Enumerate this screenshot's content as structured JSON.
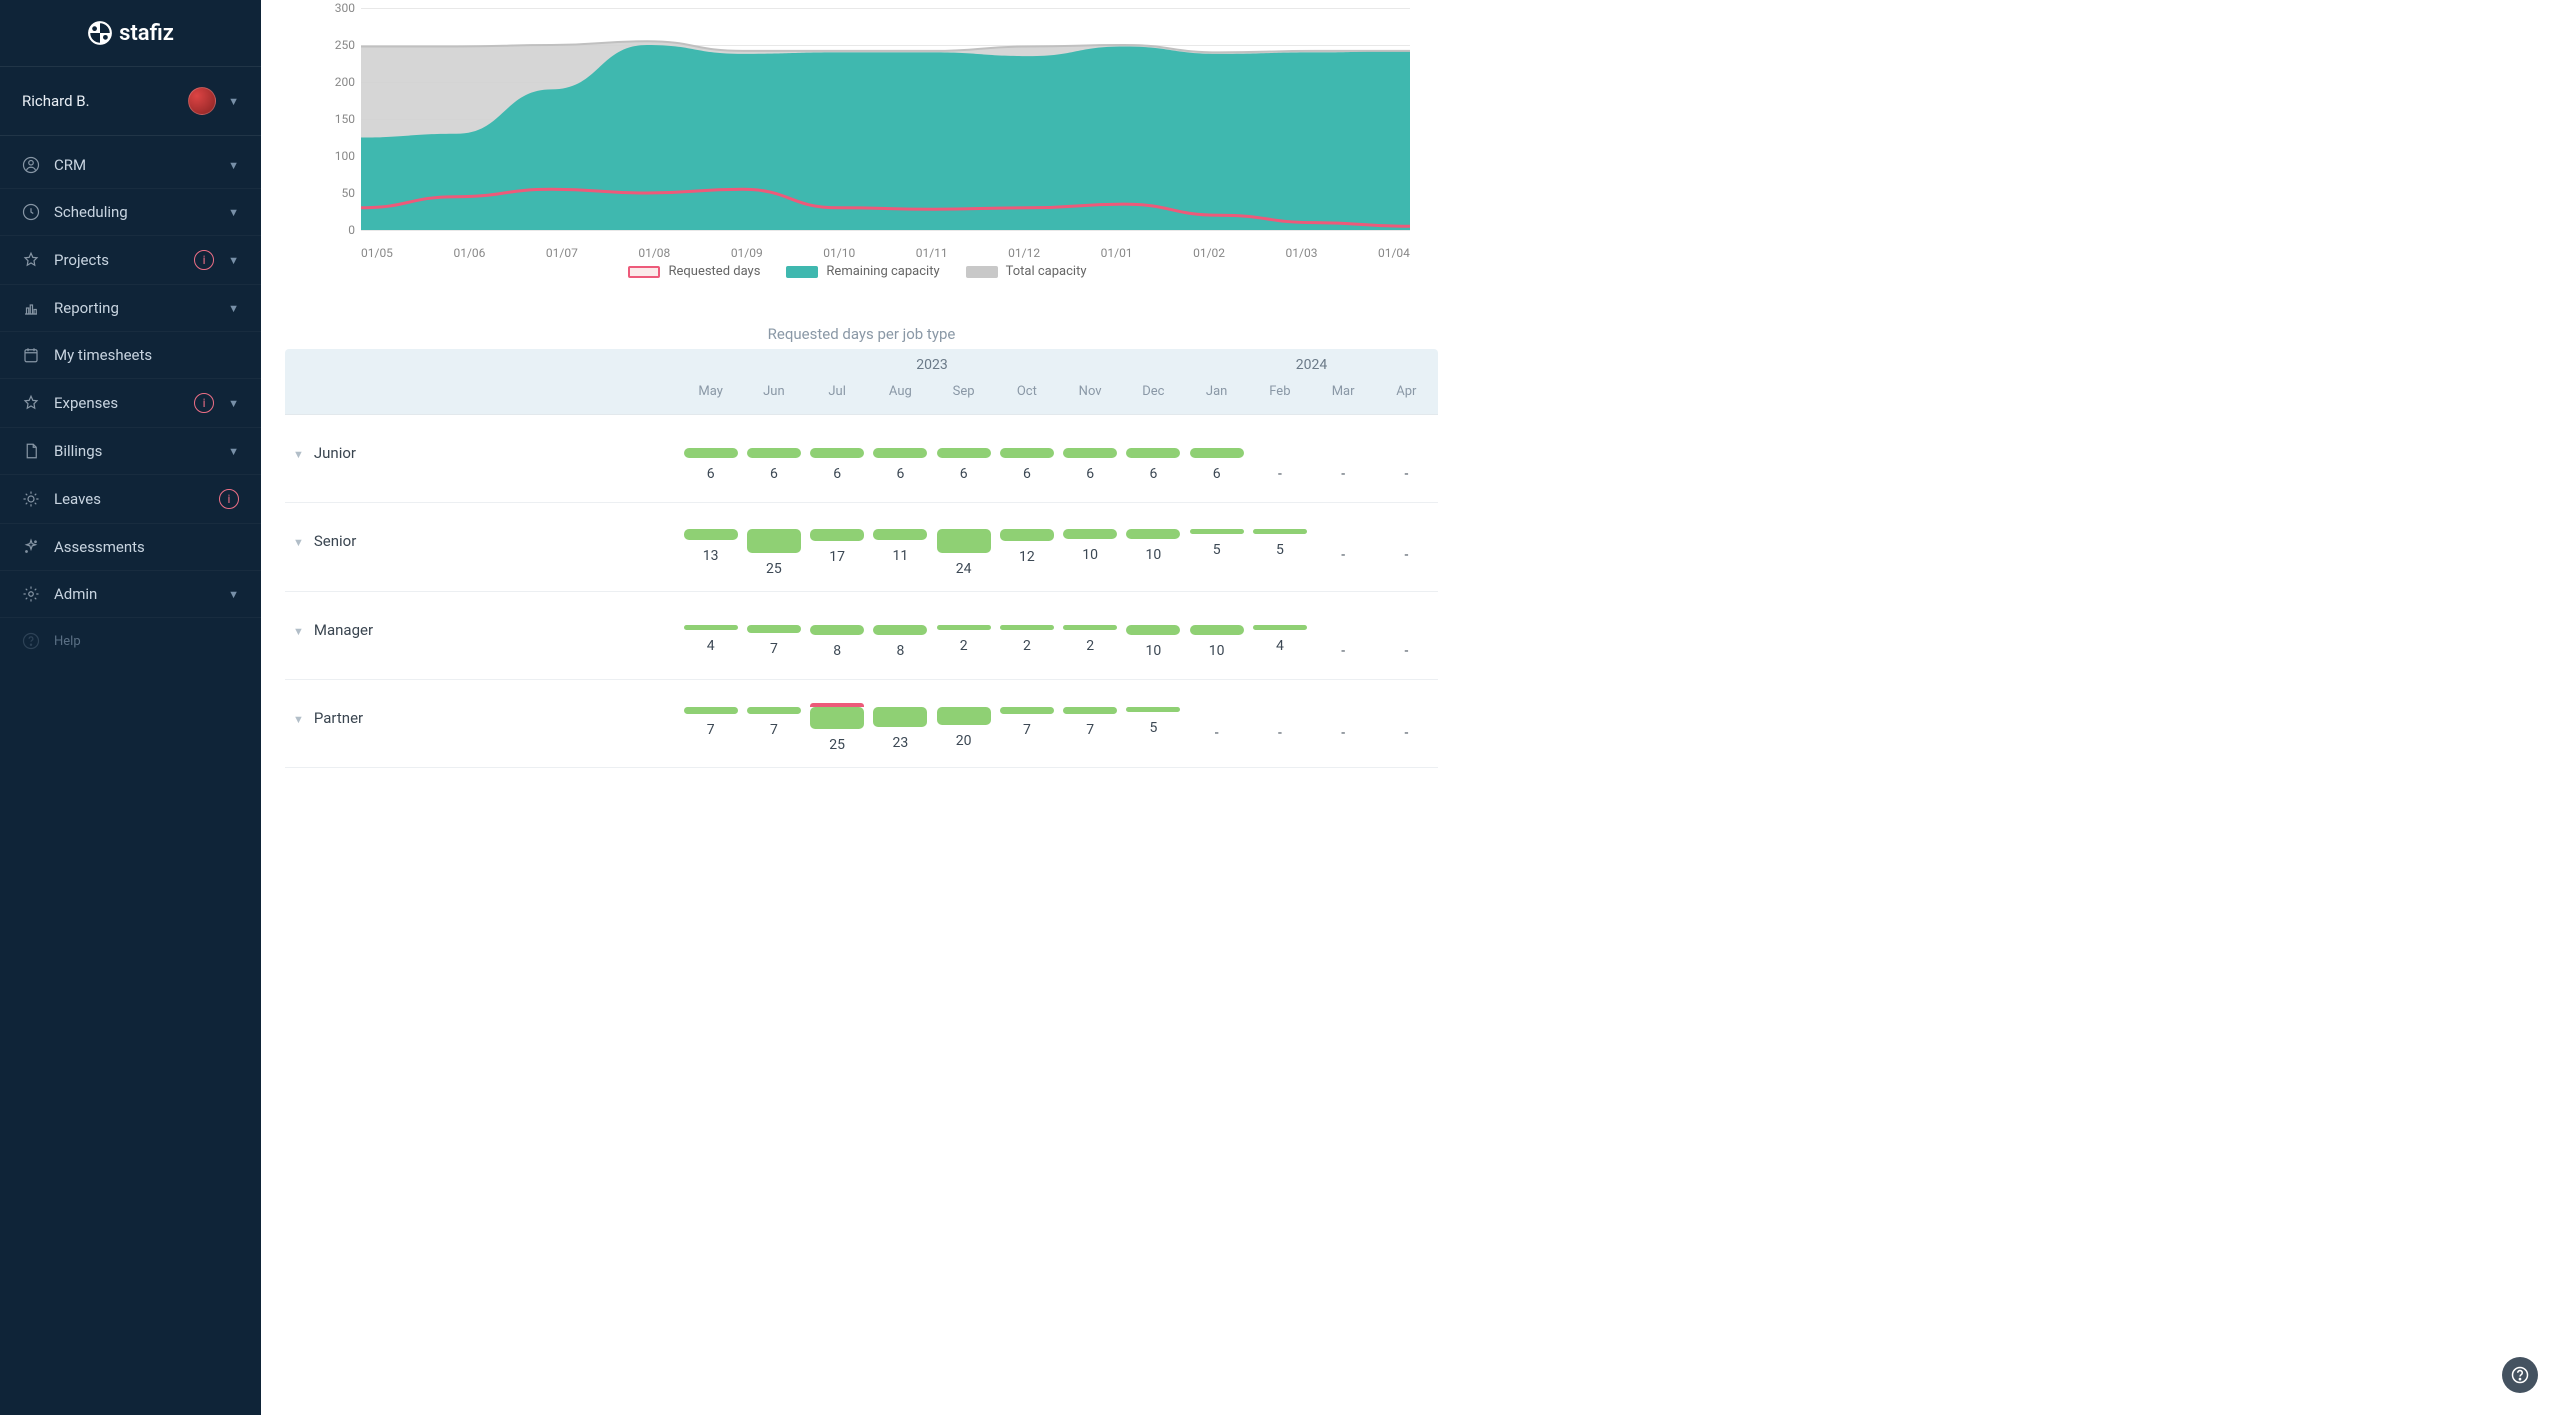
{
  "brand": "stafiz",
  "user": {
    "name": "Richard B."
  },
  "sidebar": {
    "items": [
      {
        "label": "CRM",
        "icon": "user-circle",
        "expandable": true
      },
      {
        "label": "Scheduling",
        "icon": "clock",
        "expandable": true
      },
      {
        "label": "Projects",
        "icon": "star",
        "expandable": true,
        "badge": true
      },
      {
        "label": "Reporting",
        "icon": "bar-chart",
        "expandable": true
      },
      {
        "label": "My timesheets",
        "icon": "calendar",
        "expandable": false
      },
      {
        "label": "Expenses",
        "icon": "star",
        "expandable": true,
        "badge": true
      },
      {
        "label": "Billings",
        "icon": "document",
        "expandable": true
      },
      {
        "label": "Leaves",
        "icon": "sun",
        "expandable": false,
        "badge": true
      },
      {
        "label": "Assessments",
        "icon": "sparkle",
        "expandable": false
      },
      {
        "label": "Admin",
        "icon": "gear",
        "expandable": true
      }
    ],
    "help_label": "Help"
  },
  "chart_data": {
    "type": "area",
    "title": "",
    "xlabel": "",
    "ylabel": "",
    "ylim": [
      0,
      300
    ],
    "y_ticks": [
      0,
      50,
      100,
      150,
      200,
      250,
      300
    ],
    "categories": [
      "01/05",
      "01/06",
      "01/07",
      "01/08",
      "01/09",
      "01/10",
      "01/11",
      "01/12",
      "01/01",
      "01/02",
      "01/03",
      "01/04"
    ],
    "legend": [
      "Requested days",
      "Remaining capacity",
      "Total capacity"
    ],
    "series": [
      {
        "name": "Total capacity",
        "color": "#c8c8c8",
        "values": [
          248,
          248,
          250,
          255,
          242,
          242,
          242,
          248,
          250,
          240,
          242,
          242
        ]
      },
      {
        "name": "Remaining capacity",
        "color": "#3fb8af",
        "values": [
          125,
          130,
          190,
          250,
          238,
          240,
          240,
          235,
          248,
          238,
          240,
          242
        ]
      },
      {
        "name": "Requested days",
        "color": "#ed5a7a",
        "values": [
          30,
          45,
          55,
          50,
          55,
          30,
          28,
          30,
          35,
          20,
          10,
          5
        ]
      }
    ]
  },
  "table": {
    "title": "Requested days per job type",
    "year_headers": [
      "2023",
      "2024"
    ],
    "months": [
      "May",
      "Jun",
      "Jul",
      "Aug",
      "Sep",
      "Oct",
      "Nov",
      "Dec",
      "Jan",
      "Feb",
      "Mar",
      "Apr"
    ],
    "rows": [
      {
        "name": "Junior",
        "values": [
          6,
          6,
          6,
          6,
          6,
          6,
          6,
          6,
          6,
          "-",
          "-",
          "-"
        ],
        "heights": [
          10,
          10,
          10,
          10,
          10,
          10,
          10,
          10,
          10,
          0,
          0,
          0
        ]
      },
      {
        "name": "Senior",
        "values": [
          13,
          25,
          17,
          11,
          24,
          12,
          10,
          10,
          5,
          5,
          "-",
          "-"
        ],
        "heights": [
          11,
          24,
          12,
          11,
          24,
          12,
          10,
          10,
          5,
          5,
          0,
          0
        ]
      },
      {
        "name": "Manager",
        "values": [
          4,
          7,
          8,
          8,
          2,
          2,
          2,
          10,
          10,
          4,
          "-",
          "-"
        ],
        "heights": [
          5,
          8,
          10,
          10,
          5,
          5,
          5,
          10,
          10,
          5,
          0,
          0
        ]
      },
      {
        "name": "Partner",
        "values": [
          7,
          7,
          25,
          23,
          20,
          7,
          7,
          5,
          "-",
          "-",
          "-",
          "-"
        ],
        "heights": [
          7,
          7,
          22,
          20,
          18,
          7,
          7,
          5,
          0,
          0,
          0,
          0
        ],
        "cap": [
          false,
          false,
          true,
          false,
          false,
          false,
          false,
          false,
          false,
          false,
          false,
          false
        ]
      }
    ]
  }
}
